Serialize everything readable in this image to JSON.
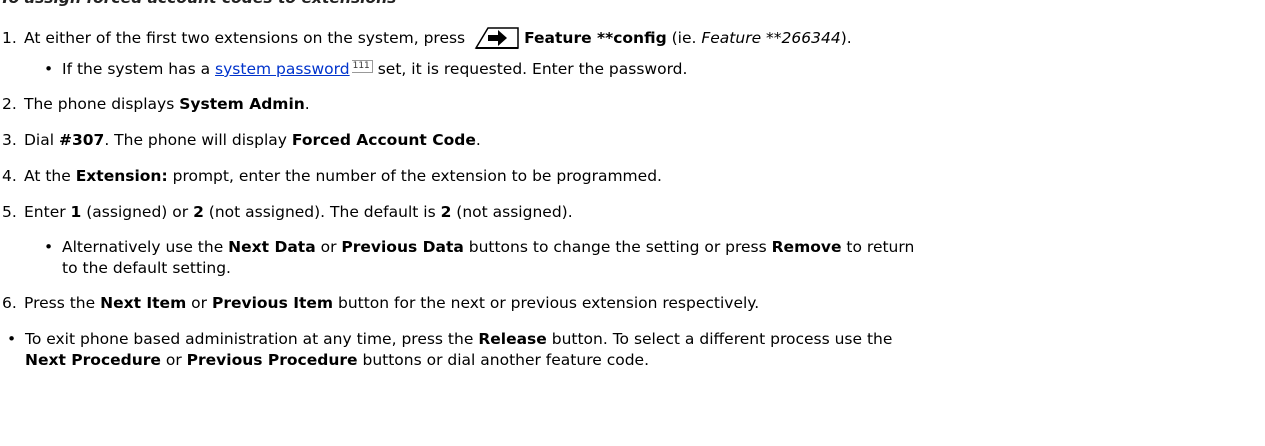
{
  "clipped_heading": "To assign forced account codes to extensions",
  "steps": [
    {
      "num": "1.",
      "t1": "At either of the first two extensions on the system, press ",
      "key_icon": "feature-key-icon",
      "b1": "Feature **config",
      "t2": " (ie. ",
      "i1": "Feature **266344",
      "t3": ")."
    },
    {
      "num": "2.",
      "t1": "The phone displays ",
      "b1": "System Admin",
      "t2": "."
    },
    {
      "num": "3.",
      "t1": "Dial ",
      "b1": "#307",
      "t2": ". The phone will display ",
      "b2": "Forced Account Code",
      "t3": "."
    },
    {
      "num": "4.",
      "t1": "At the ",
      "b1": "Extension:",
      "t2": " prompt, enter the number of the extension to be programmed."
    },
    {
      "num": "5.",
      "t1": "Enter ",
      "b1": "1",
      "t2": " (assigned) or ",
      "b2": "2",
      "t3": " (not assigned). The default is ",
      "b3": "2",
      "t4": " (not assigned)."
    },
    {
      "num": "6.",
      "t1": "Press the ",
      "b1": "Next Item",
      "t2": " or ",
      "b2": "Previous Item",
      "t3": " button for the next or previous extension respectively."
    }
  ],
  "sub1": {
    "t1": "If the system has a ",
    "link": "system password",
    "ref": "111",
    "t2": " set, it is requested. Enter the password."
  },
  "sub5": {
    "t1": "Alternatively use the ",
    "b1": "Next Data",
    "t2": " or ",
    "b2": "Previous Data",
    "t3": " buttons to change the setting or press ",
    "b3": "Remove",
    "t4": " to return",
    "line2": "to the default setting."
  },
  "bottom": {
    "t1": "To exit phone based administration at any time, press the ",
    "b1": "Release",
    "t2": " button. To select a different process use the",
    "b2": "Next Procedure",
    "t3": " or ",
    "b3": "Previous Procedure",
    "t4": " buttons or dial another feature code."
  }
}
